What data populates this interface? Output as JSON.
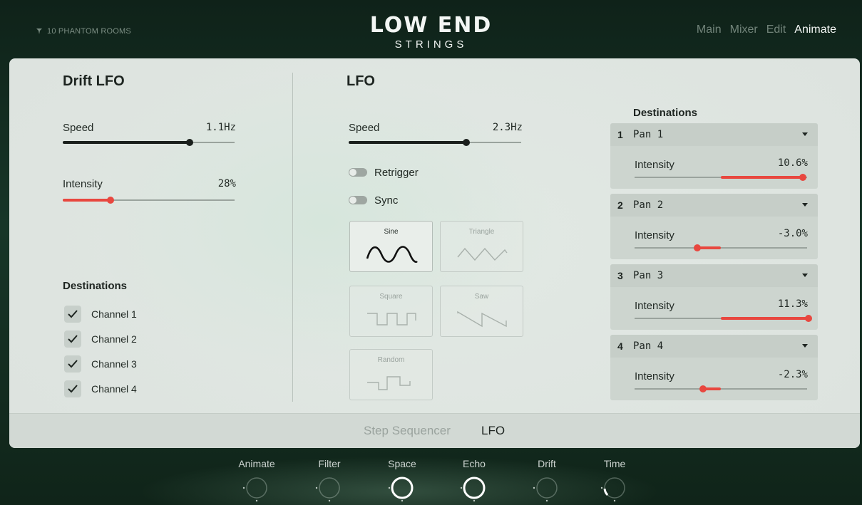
{
  "header": {
    "brand": "10 PHANTOM ROOMS",
    "brand_icon": "bird-logo-icon",
    "title": "LOW END",
    "subtitle": "STRINGS",
    "nav": [
      {
        "label": "Main",
        "active": false
      },
      {
        "label": "Mixer",
        "active": false
      },
      {
        "label": "Edit",
        "active": false
      },
      {
        "label": "Animate",
        "active": true
      }
    ]
  },
  "drift_lfo": {
    "title": "Drift LFO",
    "speed": {
      "label": "Speed",
      "value": "1.1Hz",
      "position": 0.74
    },
    "intensity": {
      "label": "Intensity",
      "value": "28%",
      "position": 0.28
    },
    "destinations_title": "Destinations",
    "channels": [
      {
        "label": "Channel 1",
        "checked": true
      },
      {
        "label": "Channel 2",
        "checked": true
      },
      {
        "label": "Channel 3",
        "checked": true
      },
      {
        "label": "Channel 4",
        "checked": true
      }
    ]
  },
  "lfo": {
    "title": "LFO",
    "speed": {
      "label": "Speed",
      "value": "2.3Hz",
      "position": 0.68
    },
    "retrigger": {
      "label": "Retrigger",
      "on": false
    },
    "sync": {
      "label": "Sync",
      "on": false
    },
    "waveforms": [
      {
        "label": "Sine",
        "active": true
      },
      {
        "label": "Triangle",
        "active": false
      },
      {
        "label": "Square",
        "active": false
      },
      {
        "label": "Saw",
        "active": false
      },
      {
        "label": "Random",
        "active": false
      }
    ],
    "destinations_title": "Destinations",
    "destinations": [
      {
        "num": "1",
        "name": "Pan 1",
        "intensity_label": "Intensity",
        "intensity": "10.6%",
        "amount": 0.106
      },
      {
        "num": "2",
        "name": "Pan 2",
        "intensity_label": "Intensity",
        "intensity": "-3.0%",
        "amount": -0.03
      },
      {
        "num": "3",
        "name": "Pan 3",
        "intensity_label": "Intensity",
        "intensity": "11.3%",
        "amount": 0.113
      },
      {
        "num": "4",
        "name": "Pan 4",
        "intensity_label": "Intensity",
        "intensity": "-2.3%",
        "amount": -0.023
      }
    ]
  },
  "bottom_tabs": [
    {
      "label": "Step Sequencer",
      "active": false
    },
    {
      "label": "LFO",
      "active": true
    }
  ],
  "knobs": [
    {
      "label": "Animate",
      "value": 0.0,
      "active": false
    },
    {
      "label": "Filter",
      "value": 0.0,
      "active": false
    },
    {
      "label": "Space",
      "value": 0.85,
      "active": true
    },
    {
      "label": "Echo",
      "value": 1.0,
      "active": true
    },
    {
      "label": "Drift",
      "value": 0.0,
      "active": false
    },
    {
      "label": "Time",
      "value": 0.15,
      "active": false
    }
  ],
  "colors": {
    "accent_red": "#e8473f",
    "slider_dark": "#1a1f1c",
    "track": "#9aa39d"
  }
}
